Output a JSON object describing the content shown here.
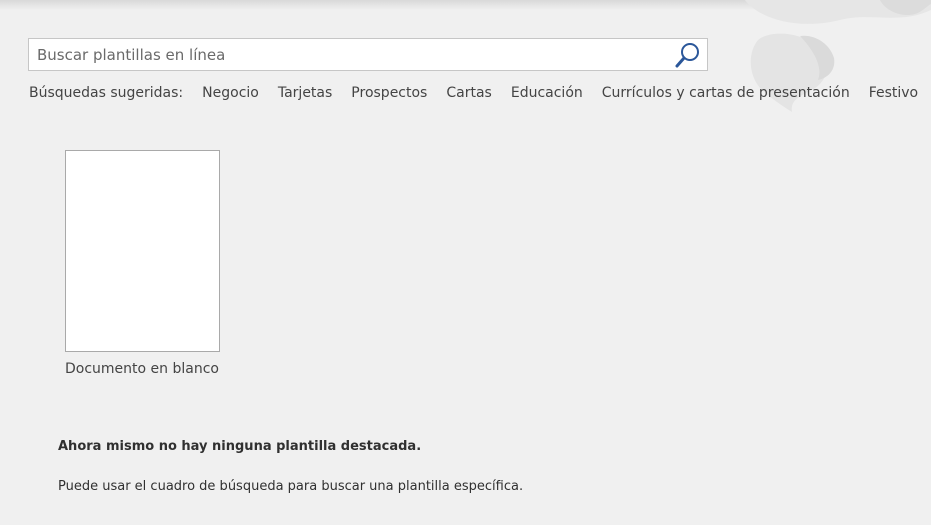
{
  "search": {
    "placeholder": "Buscar plantillas en línea",
    "icon": "search-icon"
  },
  "suggested_searches": {
    "label": "Búsquedas sugeridas:",
    "items": [
      "Negocio",
      "Tarjetas",
      "Prospectos",
      "Cartas",
      "Educación",
      "Currículos y cartas de presentación",
      "Festivo"
    ]
  },
  "templates": [
    {
      "label": "Documento en blanco"
    }
  ],
  "messages": {
    "no_featured": "Ahora mismo no hay ninguna plantilla destacada.",
    "hint": "Puede usar el cuadro de búsqueda para buscar una plantilla específica."
  },
  "colors": {
    "background": "#f0f0f0",
    "text": "#444444",
    "search_icon": "#2b579a"
  }
}
